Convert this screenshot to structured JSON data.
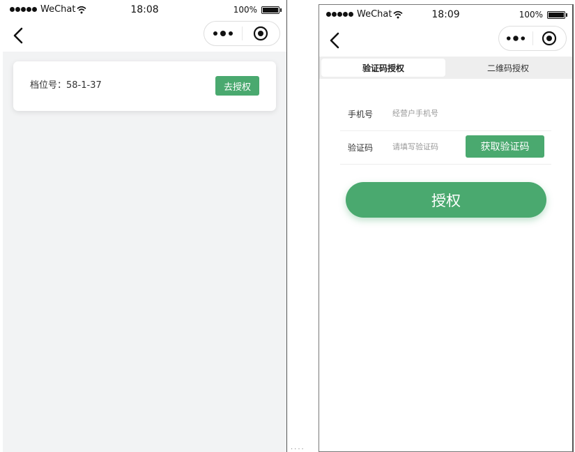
{
  "left_screen": {
    "status_bar": {
      "carrier": "WeChat",
      "time": "18:08",
      "battery": "100%"
    },
    "nav": {
      "back_icon": "chevron-left-icon",
      "more_icon": "more-dots-icon",
      "close_icon": "target-circle-icon"
    },
    "stall_card": {
      "label": "档位号：58-1-37",
      "button": "去授权"
    }
  },
  "right_screen": {
    "status_bar": {
      "carrier": "WeChat",
      "time": "18:09",
      "battery": "100%"
    },
    "nav": {
      "back_icon": "chevron-left-icon",
      "more_icon": "more-dots-icon",
      "close_icon": "target-circle-icon"
    },
    "tabs": [
      {
        "label": "验证码授权",
        "active": true
      },
      {
        "label": "二维码授权",
        "active": false
      }
    ],
    "form": {
      "phone_label": "手机号",
      "phone_placeholder": "经营户手机号",
      "code_label": "验证码",
      "code_placeholder": "请填写验证码",
      "get_code_button": "获取验证码"
    },
    "submit_button": "授权"
  },
  "colors": {
    "accent_green": "#4aa96f",
    "page_background": "#f2f3f4",
    "tab_background": "#eeeeee"
  }
}
